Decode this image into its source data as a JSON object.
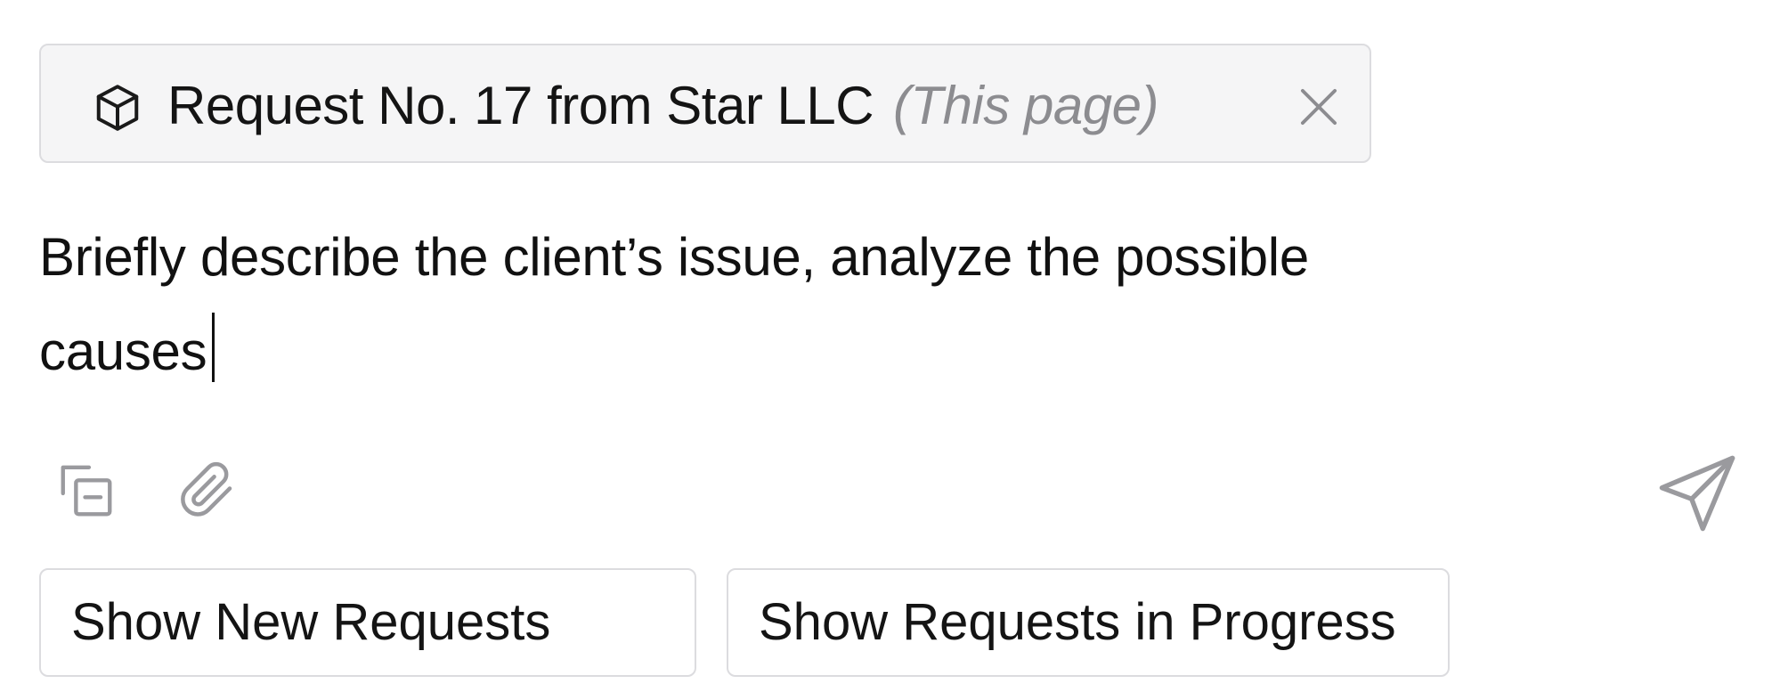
{
  "context_chip": {
    "icon": "cube-icon",
    "title": "Request No. 17 from Star LLC",
    "note": "(This page)",
    "close_icon": "close-icon"
  },
  "prompt": {
    "text": "Briefly describe the client’s issue, analyze the possible causes"
  },
  "toolbar": {
    "context_icon": "add-context-icon",
    "attach_icon": "paperclip-icon",
    "send_icon": "send-icon"
  },
  "quick_actions": [
    {
      "label": "Show New Requests"
    },
    {
      "label": "Show Requests in Progress"
    }
  ],
  "colors": {
    "chip_background": "#f5f5f6",
    "border": "#dcdcdf",
    "muted_text": "#8c8c90",
    "icon_gray": "#9a9a9e",
    "text": "#111111"
  }
}
